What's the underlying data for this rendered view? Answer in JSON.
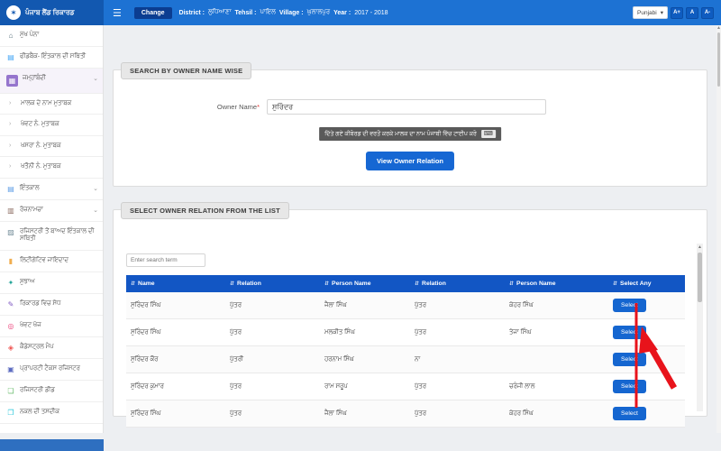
{
  "header": {
    "logo_title": "ਪੰਜਾਬ ਲੈਂਡ ਰਿਕਾਰਡ",
    "emblem_glyph": "✶",
    "hamburger_glyph": "☰",
    "change_button": "Change",
    "district_label": "District :",
    "district_value": "ਲੁਧਿਆਣਾ",
    "tehsil_label": "Tehsil :",
    "tehsil_value": "ਪਾਇਲ",
    "village_label": "Village :",
    "village_value": "ਘੁਲਾਲਪੁਰ",
    "year_label": "Year :",
    "year_value": "2017 - 2018",
    "language_selected": "Punjabi",
    "language_caret": "▾",
    "font_increase": "A+",
    "font_normal": "A",
    "font_decrease": "A-"
  },
  "sidebar": {
    "items": [
      {
        "label": "ਮੁੱਖ ਪੰਨਾ",
        "glyph": "⌂",
        "color": "#546e7a"
      },
      {
        "label": "ਫੀਡਬੈਕ- ਇੰਤਕਾਲ ਦੀ ਸਥਿਤੀ",
        "glyph": "▤",
        "color": "#42a5f5"
      },
      {
        "label": "ਜਮ੍ਹਾਂਬੰਦੀ",
        "glyph": "▦",
        "color": "#9575cd",
        "chevron": "⌄"
      },
      {
        "label": "ਮਾਲਕ ਦੇ ਨਾਮ ਮੁਤਾਬਕ",
        "glyph": "›",
        "submenu": true
      },
      {
        "label": "ਖੇਵਟ ਨੰ. ਮੁਤਾਬਕ",
        "glyph": "›",
        "submenu": true
      },
      {
        "label": "ਖਸਰਾ ਨੰ. ਮੁਤਾਬਕ",
        "glyph": "›",
        "submenu": true
      },
      {
        "label": "ਖਤੌਨੀ ਨੰ. ਮੁਤਾਬਕ",
        "glyph": "›",
        "submenu": true
      },
      {
        "label": "ਇੰਤਕਾਲ",
        "glyph": "▤",
        "color": "#5c9ce6",
        "chevron": "⌄"
      },
      {
        "label": "ਰੋਜ਼ਨਾਮਚਾ",
        "glyph": "▥",
        "color": "#8d6e63",
        "chevron": "⌄"
      },
      {
        "label": "ਰਜਿਸਟਰੀ ਤੋਂ ਬਾਅਦ ਇੰਤਕਾਲ ਦੀ ਸਥਿਤੀ",
        "glyph": "▨",
        "color": "#78909c"
      },
      {
        "label": "ਲਿਟੀਗੇਟਿਵ ਜਾਇਦਾਦ",
        "glyph": "▮",
        "color": "#f0ad4e"
      },
      {
        "label": "ਸੁਝਾਅ",
        "glyph": "✦",
        "color": "#26a69a"
      },
      {
        "label": "ਰਿਕਾਰਡ ਵਿਚ ਸੋਧ",
        "glyph": "✎",
        "color": "#7e57c2"
      },
      {
        "label": "ਖੇਵਟ ਖੋਜ",
        "glyph": "◎",
        "color": "#ec407a"
      },
      {
        "label": "ਕੈਡੇਸਟ੍ਰਲ ਮੈਪ",
        "glyph": "◈",
        "color": "#ef5350"
      },
      {
        "label": "ਪ੍ਰਾਪਰਟੀ ਟੈਕਸ ਰਜਿਸਟਰ",
        "glyph": "▣",
        "color": "#5c6bc0"
      },
      {
        "label": "ਰਜਿਸਟਰੀ ਡੀਡ",
        "glyph": "❏",
        "color": "#66bb6a"
      },
      {
        "label": "ਨਕਲ ਦੀ ਤਸਦੀਕ",
        "glyph": "❐",
        "color": "#26c6da"
      }
    ]
  },
  "search_section": {
    "title": "SEARCH BY OWNER NAME WISE",
    "owner_label": "Owner Name",
    "required_mark": "*",
    "owner_value": "ਸੁਰਿੰਦਰ",
    "hint_text": "ਦਿੱਤੇ ਗਏ ਕੀਬੋਰਡ ਦੀ ਵਰਤੋਂ ਕਰਕੇ ਮਾਲਕ ਦਾ ਨਾਮ ਪੰਜਾਬੀ ਵਿੱਚ ਟਾਈਪ ਕਰੋ",
    "keyboard_icon_glyph": "⌨",
    "view_button": "View Owner Relation"
  },
  "relation_section": {
    "title": "SELECT OWNER RELATION FROM THE LIST",
    "search_placeholder": "Enter search term",
    "sort_icon_glyph": "⇵",
    "table": {
      "headers": [
        "Name",
        "Relation",
        "Person Name",
        "Relation",
        "Person Name",
        "Select Any"
      ],
      "rows": [
        {
          "name": "ਸੁਰਿੰਦਰ ਸਿੰਘ",
          "relation1": "ਪੁੱਤਰ",
          "person1": "ਜੈਲਾ ਸਿੰਘ",
          "relation2": "ਪੁੱਤਰ",
          "person2": "ਕੇਹਰ ਸਿੰਘ",
          "select": "Select"
        },
        {
          "name": "ਸੁਰਿੰਦਰ ਸਿੰਘ",
          "relation1": "ਪੁੱਤਰ",
          "person1": "ਮਲਕੀਤ ਸਿੰਘ",
          "relation2": "ਪੁੱਤਰ",
          "person2": "ਤੇਜਾ ਸਿੰਘ",
          "select": "Select"
        },
        {
          "name": "ਸੁਰਿੰਦਰ ਕੌਰ",
          "relation1": "ਪੁੱਤਰੀ",
          "person1": "ਹਰਨਾਮ ਸਿੰਘ",
          "relation2": "ਨਾ",
          "person2": "",
          "select": "Select"
        },
        {
          "name": "ਸੁਰਿੰਦਰ ਕੁਮਾਰ",
          "relation1": "ਪੁੱਤਰ",
          "person1": "ਰਾਮ ਸਰੂਪ",
          "relation2": "ਪੁੱਤਰ",
          "person2": "ਚਰੰਜੀ ਲਾਲ",
          "select": "Select"
        },
        {
          "name": "ਸੁਰਿੰਦਰ ਸਿੰਘ",
          "relation1": "ਪੁੱਤਰ",
          "person1": "ਜੈਲਾ ਸਿੰਘ",
          "relation2": "ਪੁੱਤਰ",
          "person2": "ਕੇਹਰ ਸਿੰਘ",
          "select": "Select"
        }
      ]
    }
  },
  "colors": {
    "header_blue": "#1d72d3",
    "logo_blue": "#1258b0",
    "table_header_blue": "#1256c4",
    "button_blue": "#1667d3",
    "active_icon_purple": "#9575cd",
    "annotation_red": "#e8131b"
  }
}
